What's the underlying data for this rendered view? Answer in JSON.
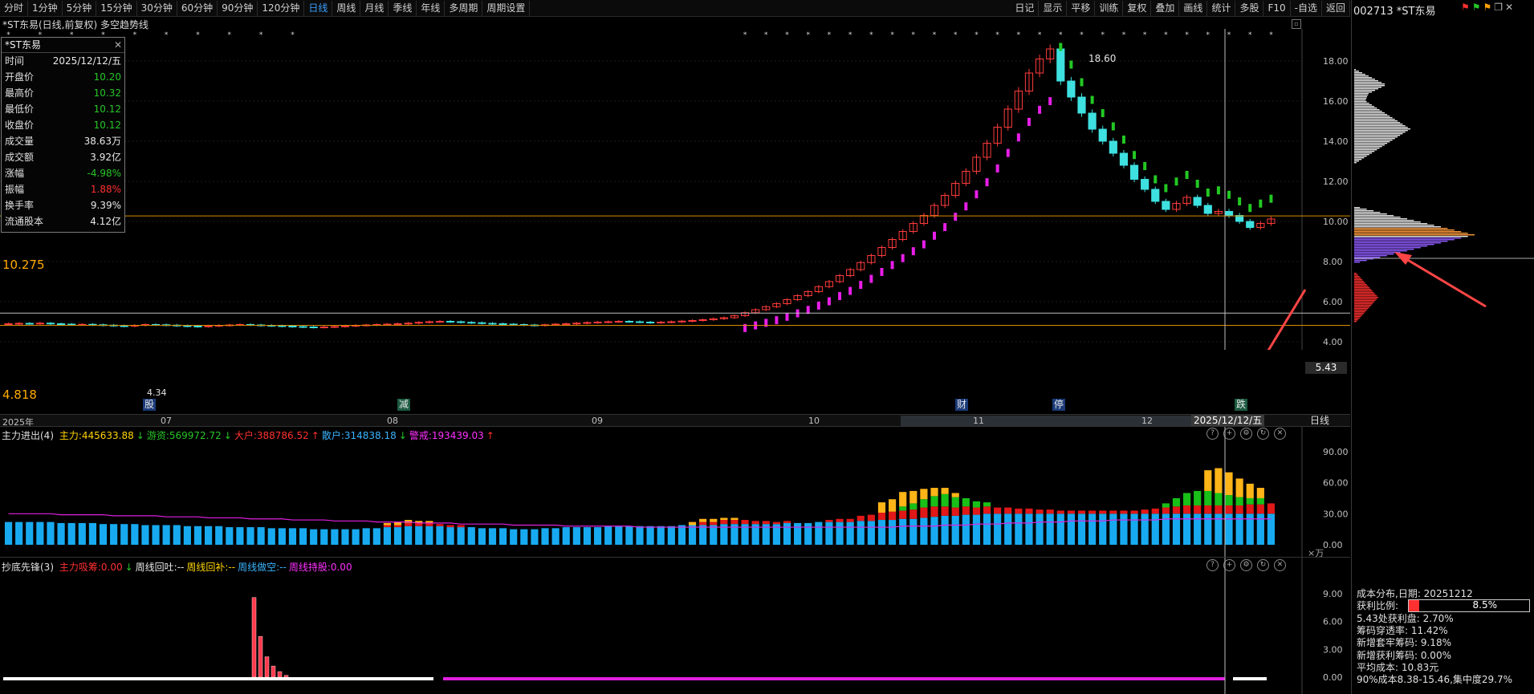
{
  "toolbar": {
    "periods": [
      "分时",
      "1分钟",
      "5分钟",
      "15分钟",
      "30分钟",
      "60分钟",
      "90分钟",
      "120分钟",
      "日线",
      "周线",
      "月线",
      "季线",
      "年线",
      "多周期",
      "周期设置"
    ],
    "active_period": "日线",
    "right_buttons": [
      "日记",
      "显示",
      "平移",
      "训练",
      "复权",
      "叠加",
      "画线",
      "统计",
      "多股",
      "F10",
      "-自选",
      "返回"
    ]
  },
  "side": {
    "stock_title": "002713 *ST东易",
    "cost_lines": [
      "成本分布,日期: 20251212",
      "获利比例:",
      "5.43处获利盘: 2.70%",
      "筹码穿透率: 11.42%",
      "新增套牢筹码: 9.18%",
      "新增获利筹码: 0.00%",
      "平均成本: 10.83元",
      "90%成本8.38-15.46,集中度29.7%"
    ],
    "profit_ratio": "8.5%",
    "profit_ratio_value": 0.085
  },
  "chart_header": "*ST东易(日线,前复权) 多空趋势线",
  "info_box": {
    "title": "*ST东易",
    "rows": [
      {
        "k": "时间",
        "v": "2025/12/12/五",
        "c": "wht"
      },
      {
        "k": "开盘价",
        "v": "10.20",
        "c": "grn"
      },
      {
        "k": "最高价",
        "v": "10.32",
        "c": "grn"
      },
      {
        "k": "最低价",
        "v": "10.12",
        "c": "grn"
      },
      {
        "k": "收盘价",
        "v": "10.12",
        "c": "grn"
      },
      {
        "k": "成交量",
        "v": "38.63万",
        "c": "wht"
      },
      {
        "k": "成交额",
        "v": "3.92亿",
        "c": "wht"
      },
      {
        "k": "涨幅",
        "v": "-4.98%",
        "c": "grn"
      },
      {
        "k": "振幅",
        "v": "1.88%",
        "c": "red"
      },
      {
        "k": "换手率",
        "v": "9.39%",
        "c": "wht"
      },
      {
        "k": "流通股本",
        "v": "4.12亿",
        "c": "wht"
      }
    ]
  },
  "main_chart": {
    "yticks": [
      "18.00",
      "16.00",
      "14.00",
      "12.00",
      "10.00",
      "8.00",
      "6.00",
      "4.00"
    ],
    "ytick_values": [
      18,
      16,
      14,
      12,
      10,
      8,
      6,
      4
    ],
    "level_high": "10.275",
    "level_low": "4.818",
    "crosshair_price": "5.43",
    "peak_label": "18.60",
    "low_label": "4.34",
    "xlabels": [
      "2025年",
      "07",
      "08",
      "09",
      "10",
      "11",
      "12"
    ],
    "cursor_date": "2025/12/12/五",
    "period_tag": "日线",
    "badges": [
      "股",
      "减",
      "财",
      "停",
      "跌"
    ]
  },
  "indicator1": {
    "title": "主力进出(4)",
    "items": [
      {
        "t": "主力:445633.88",
        "color": "#ffd400"
      },
      {
        "t": "↓",
        "color": "#27c627"
      },
      {
        "t": "游资:569972.72",
        "color": "#27c627"
      },
      {
        "t": "↓",
        "color": "#27c627"
      },
      {
        "t": "大户:388786.52",
        "color": "#ff3030"
      },
      {
        "t": "↑",
        "color": "#ff3030"
      },
      {
        "t": "散户:314838.18",
        "color": "#3ab4ff"
      },
      {
        "t": "↓",
        "color": "#27c627"
      },
      {
        "t": "警戒:193439.03",
        "color": "#ff30ff"
      },
      {
        "t": "↑",
        "color": "#ff3030"
      }
    ],
    "yticks": [
      "90.00",
      "60.00",
      "30.00",
      "0.00"
    ],
    "ytick_values": [
      90,
      60,
      30,
      0
    ],
    "unit": "×万"
  },
  "indicator2": {
    "title": "抄底先锋(3)",
    "items": [
      {
        "t": "主力吸筹:0.00",
        "color": "#ff3030"
      },
      {
        "t": "↓",
        "color": "#27c627"
      },
      {
        "t": "周线回吐:--",
        "color": "#e8e8e8"
      },
      {
        "t": "周线回补:--",
        "color": "#ffd400"
      },
      {
        "t": "周线做空:--",
        "color": "#3ab4ff"
      },
      {
        "t": "周线持股:0.00",
        "color": "#ff30ff"
      }
    ],
    "yticks": [
      "9.00",
      "6.00",
      "3.00",
      "0.00"
    ],
    "ytick_values": [
      9,
      6,
      3,
      0
    ]
  },
  "chart_data": [
    {
      "type": "candlestick",
      "title": "*ST东易(日线,前复权) 多空趋势线",
      "ylim": [
        3.6,
        19.6
      ],
      "series": [
        {
          "name": "close",
          "values": [
            4.9,
            4.92,
            4.91,
            4.93,
            4.9,
            4.88,
            4.86,
            4.87,
            4.85,
            4.83,
            4.8,
            4.78,
            4.82,
            4.86,
            4.85,
            4.83,
            4.8,
            4.78,
            4.76,
            4.79,
            4.82,
            4.84,
            4.86,
            4.84,
            4.82,
            4.8,
            4.78,
            4.76,
            4.74,
            4.72,
            4.74,
            4.76,
            4.79,
            4.82,
            4.84,
            4.86,
            4.88,
            4.9,
            4.93,
            4.97,
            5.0,
            5.02,
            5.0,
            4.97,
            4.95,
            4.92,
            4.9,
            4.88,
            4.86,
            4.84,
            4.82,
            4.85,
            4.88,
            4.9,
            4.93,
            4.96,
            4.98,
            5.0,
            5.02,
            5.0,
            4.98,
            4.96,
            4.98,
            5.0,
            5.03,
            5.06,
            5.1,
            5.15,
            5.2,
            5.3,
            5.45,
            5.6,
            5.75,
            5.9,
            6.1,
            6.3,
            6.5,
            6.75,
            7.0,
            7.3,
            7.6,
            7.95,
            8.3,
            8.7,
            9.1,
            9.5,
            9.9,
            10.3,
            10.8,
            11.3,
            11.9,
            12.5,
            13.2,
            13.9,
            14.7,
            15.6,
            16.5,
            17.4,
            18.1,
            18.6,
            17.0,
            16.2,
            15.4,
            14.6,
            14.0,
            13.4,
            12.8,
            12.1,
            11.6,
            11.0,
            10.6,
            10.9,
            11.2,
            10.8,
            10.4,
            10.5,
            10.3,
            10.0,
            9.7,
            9.9,
            10.12
          ]
        }
      ]
    },
    {
      "type": "bar",
      "title": "主力进出(4)",
      "ylim": [
        0,
        100
      ],
      "series": [
        {
          "name": "散户",
          "values": [
            22,
            22,
            22,
            22,
            22,
            21,
            21,
            21,
            21,
            20,
            20,
            20,
            20,
            19,
            19,
            19,
            19,
            18,
            18,
            18,
            18,
            17,
            17,
            17,
            17,
            16,
            16,
            16,
            16,
            15,
            15,
            15,
            15,
            15,
            16,
            16,
            17,
            17,
            18,
            18,
            18,
            18,
            17,
            17,
            17,
            16,
            16,
            16,
            15,
            15,
            15,
            16,
            16,
            17,
            17,
            17,
            17,
            18,
            18,
            18,
            18,
            18,
            18,
            18,
            19,
            19,
            19,
            19,
            20,
            20,
            20,
            20,
            20,
            20,
            21,
            21,
            21,
            22,
            22,
            22,
            22,
            23,
            23,
            24,
            24,
            25,
            25,
            26,
            27,
            28,
            28,
            29,
            29,
            30,
            30,
            30,
            30,
            30,
            30,
            30,
            30,
            30,
            30,
            30,
            30,
            30,
            30,
            30,
            30,
            30,
            30,
            30,
            30,
            30,
            30,
            30,
            30,
            30,
            30,
            30,
            30
          ]
        },
        {
          "name": "大户",
          "values": [
            0,
            0,
            0,
            0,
            0,
            0,
            0,
            0,
            0,
            0,
            0,
            0,
            0,
            0,
            0,
            0,
            0,
            0,
            0,
            0,
            0,
            0,
            0,
            0,
            0,
            0,
            0,
            0,
            0,
            0,
            0,
            0,
            0,
            0,
            0,
            0,
            2,
            2,
            3,
            3,
            3,
            2,
            2,
            2,
            0,
            0,
            0,
            0,
            0,
            0,
            0,
            0,
            0,
            0,
            0,
            0,
            0,
            0,
            0,
            0,
            0,
            0,
            0,
            0,
            0,
            0,
            3,
            3,
            4,
            4,
            4,
            3,
            3,
            2,
            2,
            0,
            0,
            0,
            2,
            3,
            3,
            5,
            6,
            7,
            8,
            8,
            9,
            10,
            10,
            9,
            8,
            8,
            7,
            7,
            6,
            6,
            5,
            5,
            4,
            4,
            3,
            3,
            3,
            3,
            3,
            3,
            3,
            3,
            4,
            5,
            6,
            7,
            8,
            8,
            8,
            8,
            8,
            8,
            9,
            9,
            10
          ]
        },
        {
          "name": "游资",
          "values": [
            0,
            0,
            0,
            0,
            0,
            0,
            0,
            0,
            0,
            0,
            0,
            0,
            0,
            0,
            0,
            0,
            0,
            0,
            0,
            0,
            0,
            0,
            0,
            0,
            0,
            0,
            0,
            0,
            0,
            0,
            0,
            0,
            0,
            0,
            0,
            0,
            0,
            0,
            0,
            0,
            0,
            0,
            0,
            0,
            0,
            0,
            0,
            0,
            0,
            0,
            0,
            0,
            0,
            0,
            0,
            0,
            0,
            0,
            0,
            0,
            0,
            0,
            0,
            0,
            0,
            0,
            0,
            0,
            0,
            0,
            0,
            0,
            0,
            0,
            0,
            0,
            0,
            0,
            0,
            0,
            0,
            0,
            0,
            0,
            0,
            4,
            6,
            8,
            10,
            12,
            10,
            8,
            6,
            4,
            0,
            0,
            0,
            0,
            0,
            0,
            0,
            0,
            0,
            0,
            0,
            0,
            0,
            0,
            0,
            0,
            4,
            8,
            12,
            14,
            14,
            12,
            10,
            8,
            6,
            6
          ]
        },
        {
          "name": "主力",
          "values": [
            0,
            0,
            0,
            0,
            0,
            0,
            0,
            0,
            0,
            0,
            0,
            0,
            0,
            0,
            0,
            0,
            0,
            0,
            0,
            0,
            0,
            0,
            0,
            0,
            0,
            0,
            0,
            0,
            0,
            0,
            0,
            0,
            0,
            0,
            0,
            0,
            2,
            3,
            3,
            2,
            2,
            0,
            0,
            0,
            0,
            0,
            0,
            0,
            0,
            0,
            0,
            0,
            0,
            0,
            0,
            0,
            0,
            0,
            0,
            0,
            0,
            0,
            0,
            0,
            0,
            3,
            3,
            3,
            2,
            2,
            0,
            0,
            0,
            0,
            0,
            0,
            0,
            0,
            0,
            0,
            0,
            0,
            0,
            10,
            12,
            14,
            12,
            10,
            8,
            6,
            4,
            0,
            0,
            0,
            0,
            0,
            0,
            0,
            0,
            0,
            0,
            0,
            0,
            0,
            0,
            0,
            0,
            0,
            0,
            0,
            0,
            0,
            0,
            0,
            20,
            24,
            22,
            18,
            14,
            10,
            0
          ]
        },
        {
          "name": "警戒",
          "values": [
            30,
            30,
            30,
            30,
            30,
            29,
            29,
            29,
            29,
            29,
            28,
            28,
            28,
            28,
            28,
            27,
            27,
            27,
            27,
            26,
            26,
            26,
            26,
            25,
            25,
            25,
            25,
            24,
            24,
            24,
            24,
            23,
            23,
            23,
            23,
            22,
            22,
            22,
            22,
            21,
            21,
            21,
            21,
            20,
            20,
            20,
            20,
            20,
            19,
            19,
            19,
            19,
            19,
            18,
            18,
            18,
            18,
            18,
            18,
            18,
            17,
            17,
            17,
            17,
            17,
            17,
            17,
            17,
            17,
            17,
            17,
            17,
            17,
            17,
            17,
            17,
            17,
            17,
            17,
            17,
            17,
            17,
            17,
            17,
            17,
            18,
            18,
            18,
            18,
            19,
            19,
            19,
            20,
            20,
            20,
            21,
            21,
            21,
            22,
            22,
            22,
            23,
            23,
            23,
            23,
            24,
            24,
            24,
            24,
            24,
            25,
            25,
            25,
            25,
            25,
            25,
            25,
            25,
            25,
            25,
            25
          ]
        }
      ]
    },
    {
      "type": "bar",
      "title": "抄底先锋(3)",
      "ylim": [
        0,
        11
      ],
      "series": [
        {
          "name": "主力吸筹",
          "values": [
            0,
            0,
            0,
            0,
            0,
            0,
            0,
            0,
            0,
            0,
            0,
            0,
            0,
            0,
            0,
            0,
            0,
            0,
            8.6,
            4.4,
            2.2,
            1.2,
            0.6,
            0.2,
            0,
            0
          ]
        }
      ]
    }
  ]
}
